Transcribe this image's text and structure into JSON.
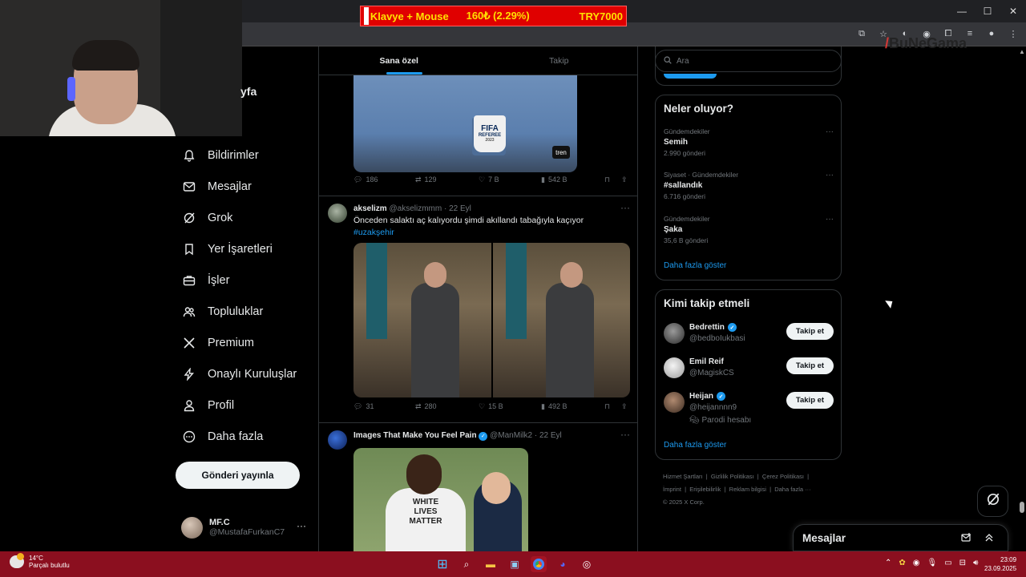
{
  "ticker": {
    "label": "Klavye + Mouse",
    "amount": "160₺ (2.29%)",
    "goal": "TRY7000"
  },
  "watermark": "BuNeGama",
  "profile_fragment": "yfa",
  "nav": {
    "items": [
      {
        "label": "Bildirimler",
        "icon": "bell-icon"
      },
      {
        "label": "Mesajlar",
        "icon": "envelope-icon"
      },
      {
        "label": "Grok",
        "icon": "grok-icon"
      },
      {
        "label": "Yer İşaretleri",
        "icon": "bookmark-icon"
      },
      {
        "label": "İşler",
        "icon": "briefcase-icon"
      },
      {
        "label": "Topluluklar",
        "icon": "people-icon"
      },
      {
        "label": "Premium",
        "icon": "x-logo-icon"
      },
      {
        "label": "Onaylı Kuruluşlar",
        "icon": "lightning-icon"
      },
      {
        "label": "Profil",
        "icon": "person-icon"
      },
      {
        "label": "Daha fazla",
        "icon": "more-circle-icon"
      }
    ],
    "post_button": "Gönderi yayınla"
  },
  "account": {
    "name": "MF.C",
    "handle": "@MustafaFurkanC7"
  },
  "feed": {
    "tabs": [
      {
        "label": "Sana özel",
        "active": true
      },
      {
        "label": "Takip",
        "active": false
      }
    ],
    "tweet1": {
      "badge_top": "FIFA",
      "badge_bottom": "REFEREE",
      "badge_year": "2023",
      "sleeve": "tren",
      "replies": "186",
      "reposts": "129",
      "likes": "7 B",
      "views": "542 B"
    },
    "tweet2": {
      "name": "akselizm",
      "handle": "@akselizmmm",
      "date": "· 22 Eyl",
      "text": "Önceden salaktı aç kalıyordu şimdi akıllandı tabağıyla kaçıyor",
      "hashtag": "#uzakşehir",
      "replies": "31",
      "reposts": "280",
      "likes": "15 B",
      "views": "492 B"
    },
    "tweet3": {
      "name": "Images That Make You Feel Pain",
      "handle": "@ManMilk2",
      "date": "· 22 Eyl",
      "shirt_text": "WHITE\nLIVES\nMATTER"
    }
  },
  "search": {
    "placeholder": "Ara"
  },
  "trends": {
    "title": "Neler oluyor?",
    "items": [
      {
        "context": "Gündemdekiler",
        "title": "Semih",
        "count": "2.990 gönderi"
      },
      {
        "context": "Siyaset · Gündemdekiler",
        "title": "#sallandık",
        "count": "6.716 gönderi"
      },
      {
        "context": "Gündemdekiler",
        "title": "Şaka",
        "count": "35,6 B gönderi"
      }
    ],
    "show_more": "Daha fazla göster"
  },
  "who_to_follow": {
    "title": "Kimi takip etmeli",
    "items": [
      {
        "name": "Bedrettin",
        "handle": "@bedboIukbasi",
        "verified": true,
        "extra": "",
        "button": "Takip et"
      },
      {
        "name": "Emil Reif",
        "handle": "@MagiskCS",
        "verified": false,
        "extra": "",
        "button": "Takip et"
      },
      {
        "name": "Heijan",
        "handle": "@heijannnn9",
        "verified": true,
        "extra": "Parodi hesabı",
        "button": "Takip et"
      }
    ],
    "show_more": "Daha fazla göster"
  },
  "footer": {
    "line1": "Hizmet Şartları  |  Gizlilik Politikası  |  Çerez Politikası  |",
    "line2": "İmprint  |  Erişilebilirlik  |  Reklam bilgisi  |  Daha fazla ···",
    "line3": "© 2025 X Corp."
  },
  "messages_drawer": {
    "title": "Mesajlar"
  },
  "taskbar": {
    "temp": "14°C",
    "weather": "Parçalı bulutlu",
    "time": "23:09",
    "date": "23.09.2025"
  },
  "colors": {
    "accent": "#1d9bf0",
    "taskbar": "#8b0f1f",
    "ticker_bg": "#e00000",
    "ticker_text": "#ffe000"
  }
}
